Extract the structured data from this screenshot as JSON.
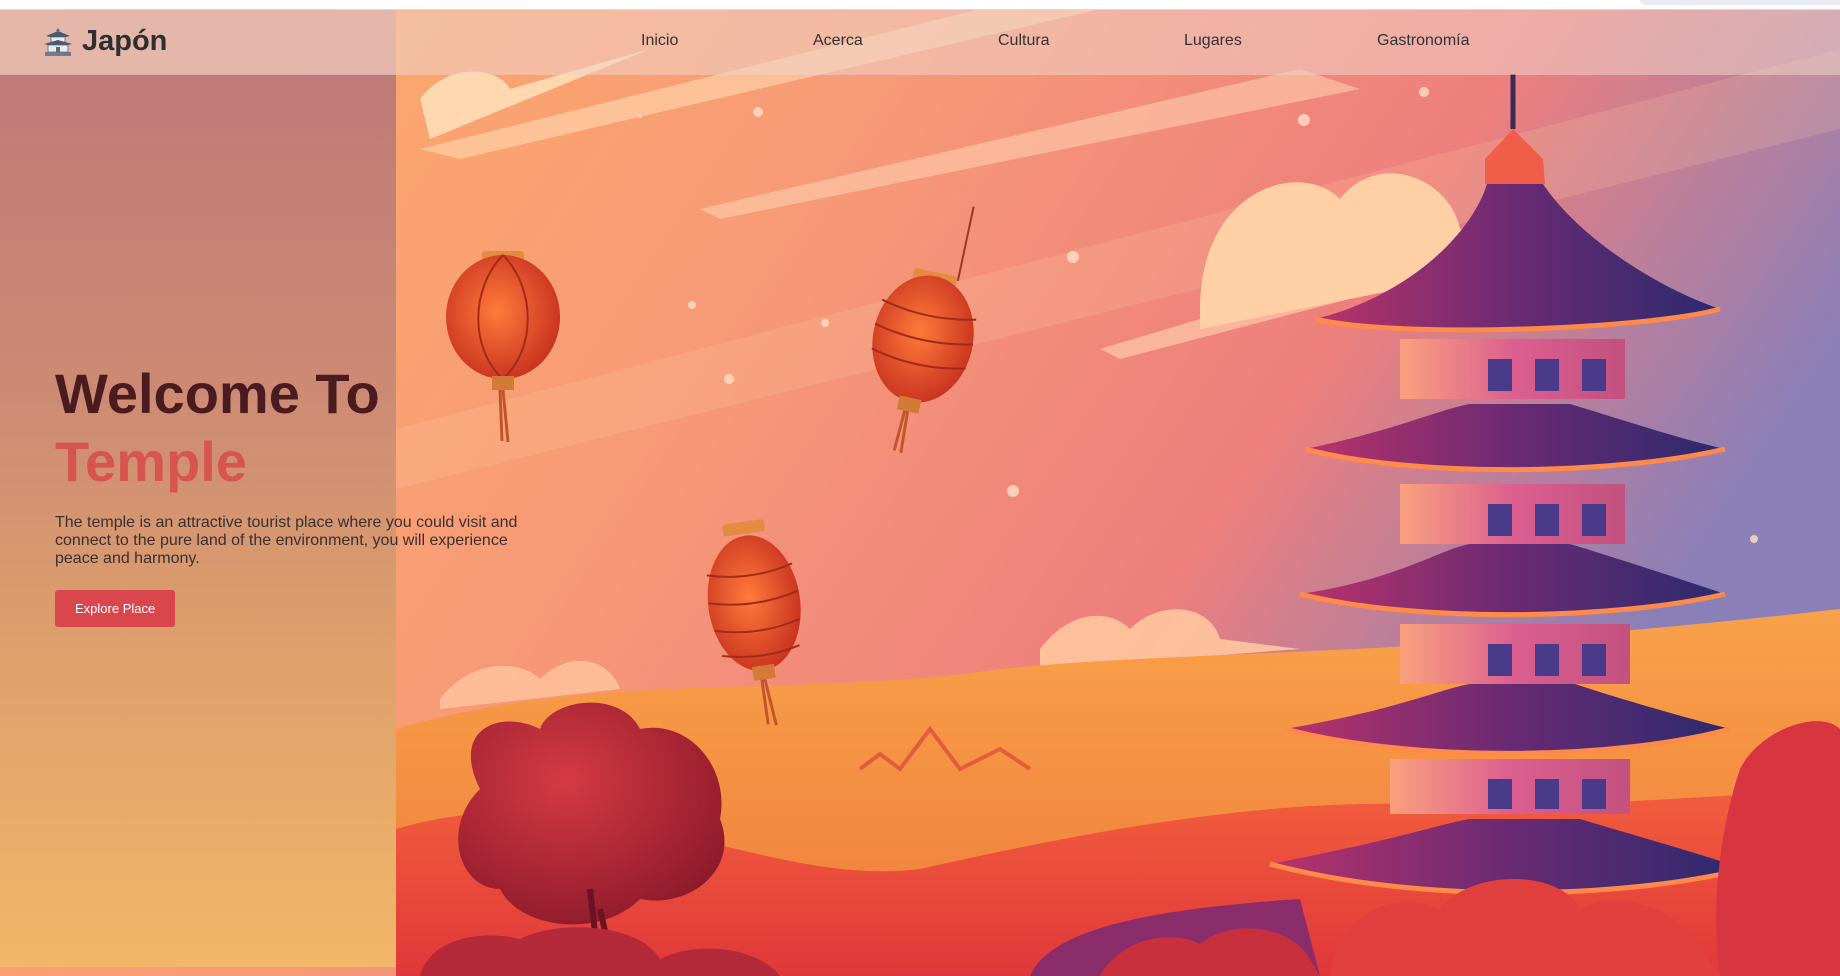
{
  "brand": {
    "name": "Japón",
    "icon": "temple-icon"
  },
  "nav": {
    "links": [
      {
        "label": "Inicio"
      },
      {
        "label": "Acerca"
      },
      {
        "label": "Cultura"
      },
      {
        "label": "Lugares"
      },
      {
        "label": "Gastronomía"
      }
    ]
  },
  "hero": {
    "title_line1": "Welcome To",
    "title_line2": "Temple",
    "description": "The temple is an attractive tourist place where you could visit and connect to the pure land of the environment, you will experience peace and harmony.",
    "cta_label": "Explore Place"
  },
  "colors": {
    "accent": "#d9474d",
    "title": "#4a1c20",
    "highlight": "#d8544f"
  }
}
